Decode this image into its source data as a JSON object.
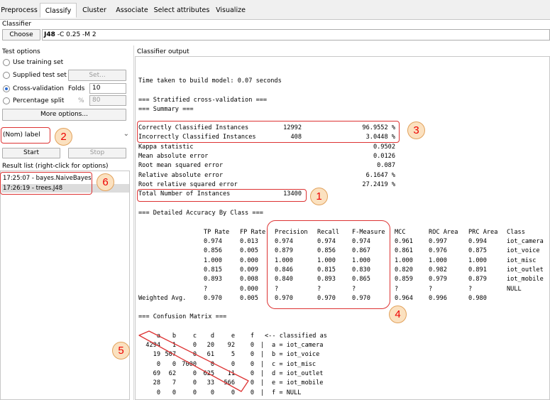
{
  "tabs": [
    "Preprocess",
    "Classify",
    "Cluster",
    "Associate",
    "Select attributes",
    "Visualize"
  ],
  "classifier": {
    "section": "Classifier",
    "choose": "Choose",
    "name": "J48",
    "options": "-C 0.25 -M 2"
  },
  "test_options": {
    "section": "Test options",
    "use_training": "Use training set",
    "supplied": "Supplied test set",
    "set_button": "Set...",
    "cross_validation": "Cross-validation",
    "folds_label": "Folds",
    "folds_value": "10",
    "percentage_split": "Percentage split",
    "percent_symbol": "%",
    "percent_value": "80",
    "more_options": "More options..."
  },
  "class_selector": {
    "value": "(Nom) label"
  },
  "actions": {
    "start": "Start",
    "stop": "Stop"
  },
  "result_list": {
    "label": "Result list (right-click for options)",
    "items": [
      "17:25:07 - bayes.NaiveBayes",
      "17:26:19 - trees.J48"
    ]
  },
  "output": {
    "label": "Classifier output",
    "time_taken": "Time taken to build model: 0.07 seconds",
    "cv_header": "=== Stratified cross-validation ===",
    "summary_header": "=== Summary ===",
    "summary": [
      {
        "label": "Correctly Classified Instances",
        "count": "12992",
        "value": "96.9552 %"
      },
      {
        "label": "Incorrectly Classified Instances",
        "count": "408",
        "value": "3.0448 %"
      },
      {
        "label": "Kappa statistic",
        "count": "",
        "value": "0.9502"
      },
      {
        "label": "Mean absolute error",
        "count": "",
        "value": "0.0126"
      },
      {
        "label": "Root mean squared error",
        "count": "",
        "value": "0.087"
      },
      {
        "label": "Relative absolute error",
        "count": "",
        "value": "6.1647 %"
      },
      {
        "label": "Root relative squared error",
        "count": "",
        "value": "27.2419 %"
      },
      {
        "label": "Total Number of Instances",
        "count": "13400",
        "value": ""
      }
    ],
    "accuracy_header": "=== Detailed Accuracy By Class ===",
    "accuracy_columns": [
      "TP Rate",
      "FP Rate",
      "Precision",
      "Recall",
      "F-Measure",
      "MCC",
      "ROC Area",
      "PRC Area",
      "Class"
    ],
    "accuracy_rows": [
      {
        "label": "",
        "cells": [
          "0.974",
          "0.013",
          "0.974",
          "0.974",
          "0.974",
          "0.961",
          "0.997",
          "0.994",
          "iot_camera"
        ]
      },
      {
        "label": "",
        "cells": [
          "0.856",
          "0.005",
          "0.879",
          "0.856",
          "0.867",
          "0.861",
          "0.976",
          "0.875",
          "iot_voice"
        ]
      },
      {
        "label": "",
        "cells": [
          "1.000",
          "0.000",
          "1.000",
          "1.000",
          "1.000",
          "1.000",
          "1.000",
          "1.000",
          "iot_misc"
        ]
      },
      {
        "label": "",
        "cells": [
          "0.815",
          "0.009",
          "0.846",
          "0.815",
          "0.830",
          "0.820",
          "0.982",
          "0.891",
          "iot_outlet"
        ]
      },
      {
        "label": "",
        "cells": [
          "0.893",
          "0.008",
          "0.840",
          "0.893",
          "0.865",
          "0.859",
          "0.979",
          "0.879",
          "iot_mobile"
        ]
      },
      {
        "label": "",
        "cells": [
          "?",
          "0.000",
          "?",
          "?",
          "?",
          "?",
          "?",
          "?",
          "NULL"
        ]
      },
      {
        "label": "Weighted Avg.",
        "cells": [
          "0.970",
          "0.005",
          "0.970",
          "0.970",
          "0.970",
          "0.964",
          "0.996",
          "0.980",
          ""
        ]
      }
    ],
    "confusion_header": "=== Confusion Matrix ===",
    "confusion_columns": [
      "a",
      "b",
      "c",
      "d",
      "e",
      "f"
    ],
    "confusion_classified_as": "<-- classified as",
    "confusion_rows": [
      {
        "cells": [
          "4294",
          "1",
          "0",
          "20",
          "92",
          "0"
        ],
        "label": "a = iot_camera"
      },
      {
        "cells": [
          "19",
          "507",
          "0",
          "61",
          "5",
          "0"
        ],
        "label": "b = iot_voice"
      },
      {
        "cells": [
          "0",
          "0",
          "7000",
          "0",
          "0",
          "0"
        ],
        "label": "c = iot_misc"
      },
      {
        "cells": [
          "69",
          "62",
          "0",
          "625",
          "11",
          "0"
        ],
        "label": "d = iot_outlet"
      },
      {
        "cells": [
          "28",
          "7",
          "0",
          "33",
          "566",
          "0"
        ],
        "label": "e = iot_mobile"
      },
      {
        "cells": [
          "0",
          "0",
          "0",
          "0",
          "0",
          "0"
        ],
        "label": "f = NULL"
      }
    ]
  },
  "annotations": [
    "1",
    "2",
    "3",
    "4",
    "5",
    "6"
  ],
  "colors": {
    "highlight": "#dd3333",
    "marker_fill": "#fbe1c0",
    "marker_text": "#ee0000"
  }
}
